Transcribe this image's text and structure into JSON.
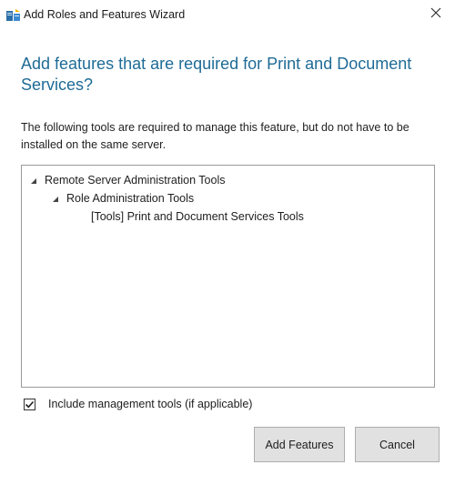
{
  "window": {
    "title": "Add Roles and Features Wizard",
    "icon": "server-manager-icon",
    "close_icon": "close-icon"
  },
  "heading": "Add features that are required for Print and Document Services?",
  "description": "The following tools are required to manage this feature, but do not have to be installed on the same server.",
  "tree": {
    "items": [
      {
        "label": "Remote Server Administration Tools",
        "expanded": true,
        "level": 0
      },
      {
        "label": "Role Administration Tools",
        "expanded": true,
        "level": 1
      },
      {
        "label": "[Tools] Print and Document Services Tools",
        "expanded": false,
        "level": 2
      }
    ]
  },
  "checkbox": {
    "label": "Include management tools (if applicable)",
    "checked": true
  },
  "buttons": {
    "add_features": "Add Features",
    "cancel": "Cancel"
  },
  "colors": {
    "heading": "#1f6b96",
    "button_bg": "#e1e1e1",
    "border": "#9a9a9a"
  }
}
